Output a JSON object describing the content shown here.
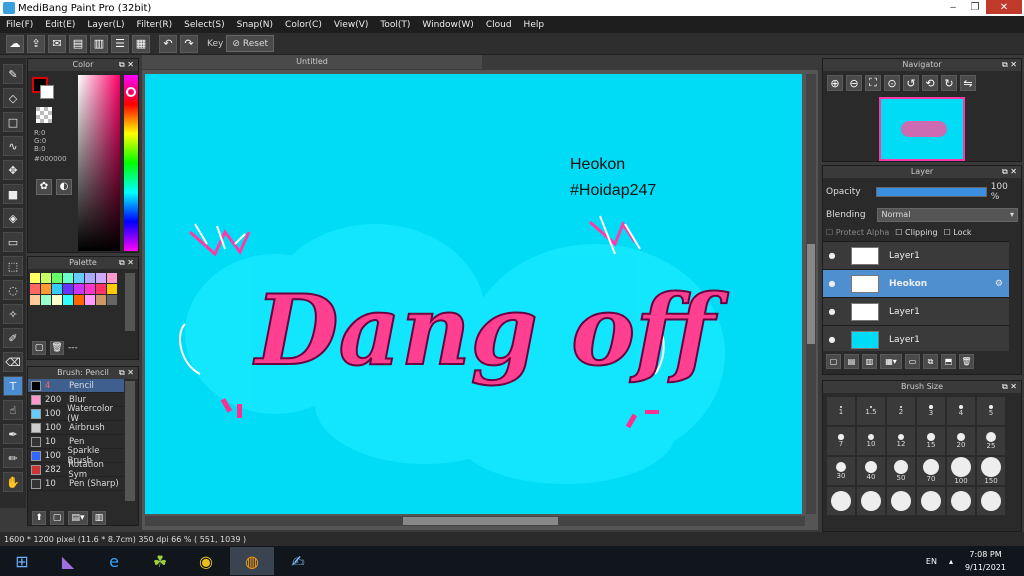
{
  "window": {
    "title": "MediBang Paint Pro (32bit)"
  },
  "menu": [
    "File(F)",
    "Edit(E)",
    "Layer(L)",
    "Filter(R)",
    "Select(S)",
    "Snap(N)",
    "Color(C)",
    "View(V)",
    "Tool(T)",
    "Window(W)",
    "Cloud",
    "Help"
  ],
  "toolbar": {
    "key_label": "Key",
    "reset_label": "Reset"
  },
  "color_panel": {
    "title": "Color",
    "r": "R:0",
    "g": "G:0",
    "b": "B:0",
    "hex": "#000000"
  },
  "palette_panel": {
    "title": "Palette",
    "colors": [
      "#ffff66",
      "#ccff66",
      "#66ff66",
      "#66ffcc",
      "#66ccff",
      "#aaaaff",
      "#ccaaff",
      "#ff99cc",
      "#ff6666",
      "#ff9933",
      "#33ccff",
      "#6633ff",
      "#cc33ff",
      "#ff33cc",
      "#ff3366",
      "#ffcc00",
      "#ffcc99",
      "#99ffcc",
      "#ffffcc",
      "#33ffff",
      "#ff6600",
      "#ff99ff",
      "#cc9966",
      "#666666"
    ],
    "more_label": "---"
  },
  "brush_panel": {
    "title": "Brush: Pencil",
    "items": [
      {
        "size": "4",
        "name": "Pencil",
        "color": "#000000"
      },
      {
        "size": "200",
        "name": "Blur",
        "color": "#ff99cc"
      },
      {
        "size": "100",
        "name": "Watercolor (W",
        "color": "#66ccff"
      },
      {
        "size": "100",
        "name": "Airbrush",
        "color": "#cccccc"
      },
      {
        "size": "10",
        "name": "Pen",
        "color": "#333333"
      },
      {
        "size": "100",
        "name": "Sparkle Brush",
        "color": "#3366ff"
      },
      {
        "size": "282",
        "name": "Rotation Sym",
        "color": "#cc3333"
      },
      {
        "size": "10",
        "name": "Pen (Sharp)",
        "color": "#333333"
      }
    ]
  },
  "canvas": {
    "tab_label": "Untitled",
    "text_line1": "Heokon",
    "text_line2": "#Hoidap247",
    "art_text": "Dang off",
    "bg": "#00dcf5"
  },
  "navigator": {
    "title": "Navigator"
  },
  "layer_panel": {
    "title": "Layer",
    "opacity_label": "Opacity",
    "opacity_value": "100 %",
    "opacity_level": 1.0,
    "blending_label": "Blending",
    "blending_value": "Normal",
    "protect_alpha": "Protect Alpha",
    "clipping": "Clipping",
    "lock": "Lock",
    "layers": [
      {
        "name": "Layer1",
        "selected": false
      },
      {
        "name": "Heokon",
        "selected": true
      },
      {
        "name": "Layer1",
        "selected": false
      },
      {
        "name": "Layer1",
        "selected": false
      }
    ]
  },
  "brush_size": {
    "title": "Brush Size",
    "sizes": [
      "1",
      "1.5",
      "2",
      "3",
      "4",
      "5",
      "7",
      "10",
      "12",
      "15",
      "20",
      "25",
      "30",
      "40",
      "50",
      "70",
      "100",
      "150"
    ]
  },
  "status": {
    "text": "1600 * 1200 pixel   (11.6 * 8.7cm)   350 dpi   66 %   ( 551, 1039 )"
  },
  "taskbar": {
    "lang": "EN",
    "time": "7:08 PM",
    "date": "9/11/2021"
  }
}
